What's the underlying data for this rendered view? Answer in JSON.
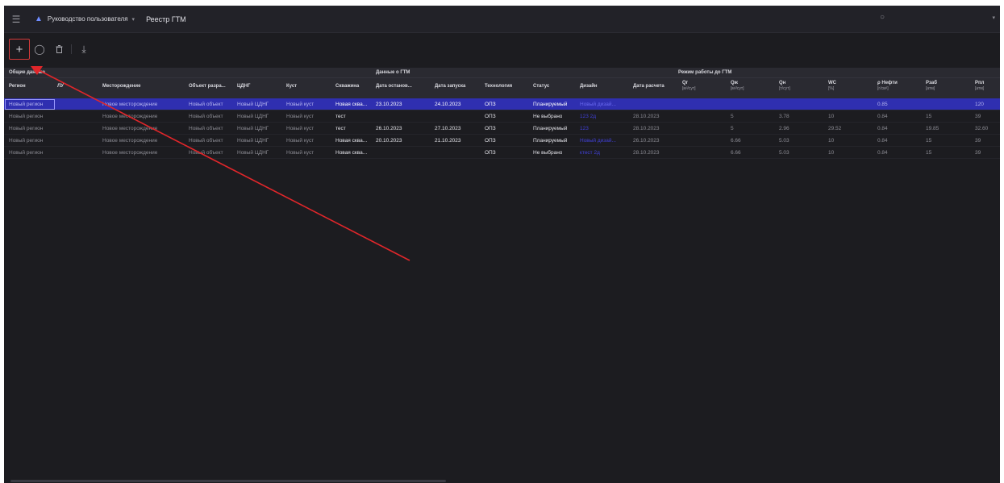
{
  "topbar": {
    "doc_title": "Руководство пользователя",
    "page_title": "Реестр ГТМ"
  },
  "icons": {
    "menu": "hamburger-icon",
    "user": "user-icon",
    "bulb": "lightbulb-icon",
    "add": "plus-icon",
    "copy": "copy-icon",
    "delete": "trash-icon",
    "download": "download-icon"
  },
  "groups": {
    "general": "Общие данные",
    "gtm": "Данные о ГТМ",
    "mode": "Режим работы до ГТМ"
  },
  "columns": {
    "region": "Регион",
    "lu": "ЛУ",
    "field": "Месторождение",
    "object": "Объект разра...",
    "cdng": "ЦДНГ",
    "bush": "Куст",
    "well": "Скважина",
    "stop_date": "Дата останов...",
    "start_date": "Дата запуска",
    "tech": "Технология",
    "status": "Статус",
    "design": "Дизайн",
    "calc_date": "Дата расчета",
    "qg": "Qг",
    "qg_unit": "[м³/сут]",
    "qzh": "Qж",
    "qzh_unit": "[м³/сут]",
    "qn": "Qн",
    "qn_unit": "[т/сут]",
    "wc": "WC",
    "wc_unit": "[%]",
    "rho": "ρ Нефти",
    "rho_unit": "[г/см³]",
    "rzab": "Рзаб",
    "rzab_unit": "[атм]",
    "rpl": "Рпл",
    "rpl_unit": "[атм]"
  },
  "rows": [
    {
      "region": "Новый регион",
      "field": "Новое месторождение",
      "object": "Новый объект",
      "cdng": "Новый ЦДНГ",
      "bush": "Новый куст",
      "well": "Новая сква...",
      "stop_date": "23.10.2023",
      "start_date": "24.10.2023",
      "tech": "ОПЗ",
      "status": "Планируемый",
      "design": "Новый дизай...",
      "calc_date": "",
      "qzh": "",
      "qn": "",
      "wc": "",
      "rho": "0.85",
      "rzab": "",
      "rpl": "120"
    },
    {
      "region": "Новый регион",
      "field": "Новое месторождение",
      "object": "Новый объект",
      "cdng": "Новый ЦДНГ",
      "bush": "Новый куст",
      "well": "тест",
      "stop_date": "",
      "start_date": "",
      "tech": "ОПЗ",
      "status": "Не выбрано",
      "design": "123 2д",
      "calc_date": "28.10.2023",
      "qzh": "5",
      "qn": "3.78",
      "wc": "10",
      "rho": "0.84",
      "rzab": "15",
      "rpl": "39"
    },
    {
      "region": "Новый регион",
      "field": "Новое месторождение",
      "object": "Новый объект",
      "cdng": "Новый ЦДНГ",
      "bush": "Новый куст",
      "well": "тест",
      "stop_date": "26.10.2023",
      "start_date": "27.10.2023",
      "tech": "ОПЗ",
      "status": "Планируемый",
      "design": "123",
      "calc_date": "28.10.2023",
      "qzh": "5",
      "qn": "2.96",
      "wc": "29.52",
      "rho": "0.84",
      "rzab": "19.85",
      "rpl": "32.60"
    },
    {
      "region": "Новый регион",
      "field": "Новое месторождение",
      "object": "Новый объект",
      "cdng": "Новый ЦДНГ",
      "bush": "Новый куст",
      "well": "Новая сква...",
      "stop_date": "20.10.2023",
      "start_date": "21.10.2023",
      "tech": "ОПЗ",
      "status": "Планируемый",
      "design": "Новый дизай...",
      "calc_date": "26.10.2023",
      "qzh": "6.66",
      "qn": "5.03",
      "wc": "10",
      "rho": "0.84",
      "rzab": "15",
      "rpl": "39"
    },
    {
      "region": "Новый регион",
      "field": "Новое месторождение",
      "object": "Новый объект",
      "cdng": "Новый ЦДНГ",
      "bush": "Новый куст",
      "well": "Новая сква...",
      "stop_date": "",
      "start_date": "",
      "tech": "ОПЗ",
      "status": "Не выбрано",
      "design": "ктест 2д",
      "calc_date": "28.10.2023",
      "qzh": "6.66",
      "qn": "5.03",
      "wc": "10",
      "rho": "0.84",
      "rzab": "15",
      "rpl": "39"
    }
  ],
  "colors": {
    "background": "#1c1c20",
    "header": "#2a2a31",
    "selected_row": "#2f2fb0",
    "annotation": "#e0262a"
  }
}
